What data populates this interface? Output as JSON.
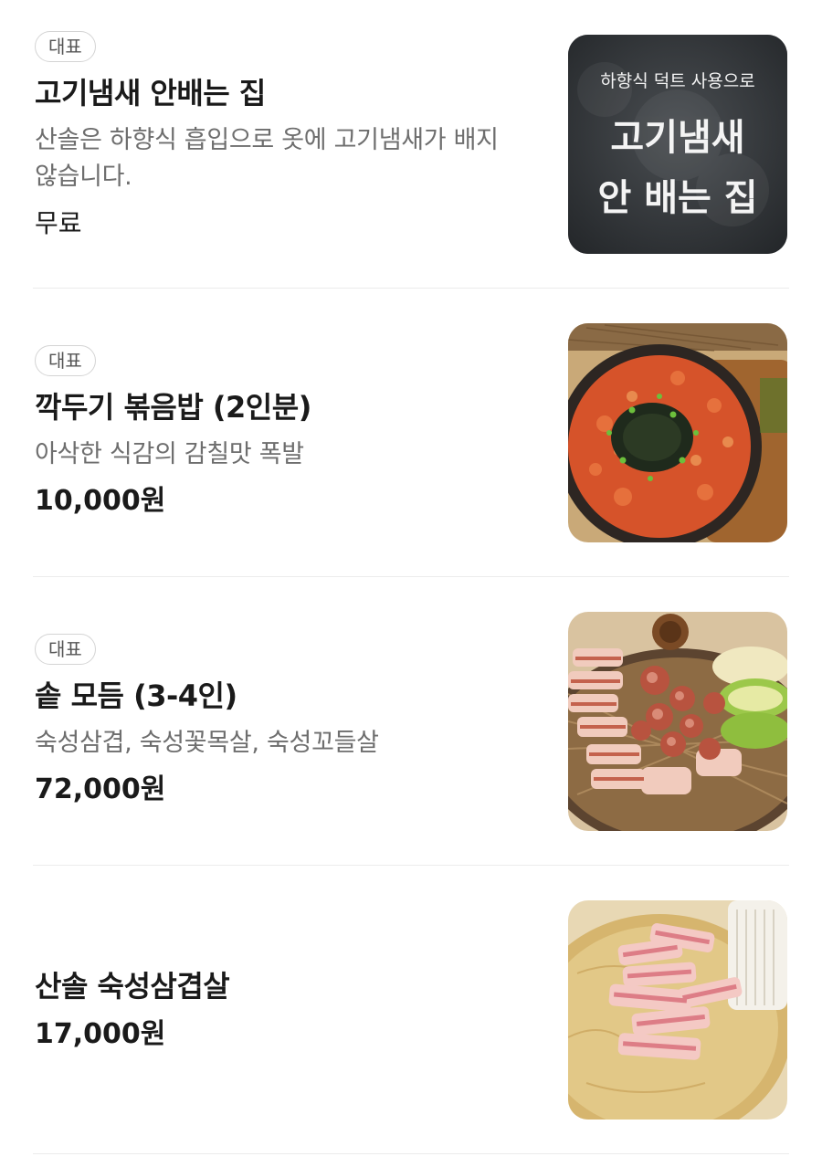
{
  "items": [
    {
      "badge": "대표",
      "name": "고기냄새 안배는 집",
      "description": "산솔은 하향식 흡입으로 옷에 고기냄새가 배지 않습니다.",
      "price": "무료",
      "image": {
        "kind": "chalkboard",
        "line1": "하향식 덕트 사용으로",
        "line2": "고기냄새",
        "line3": "안 배는 집"
      }
    },
    {
      "badge": "대표",
      "name": "깍두기 볶음밥 (2인분)",
      "description": "아삭한 식감의 감칠맛 폭발",
      "price": "10,000원"
    },
    {
      "badge": "대표",
      "name": "솥 모듬 (3-4인)",
      "description": "숙성삼겹, 숙성꽃목살, 숙성꼬들살",
      "price": "72,000원"
    },
    {
      "name": "산솔 숙성삼겹살",
      "price": "17,000원"
    }
  ],
  "colors": {
    "badge_border": "#d4d4d4",
    "divider": "#ececec",
    "text_primary": "#1a1a1a",
    "text_secondary": "#6e6e6e"
  }
}
